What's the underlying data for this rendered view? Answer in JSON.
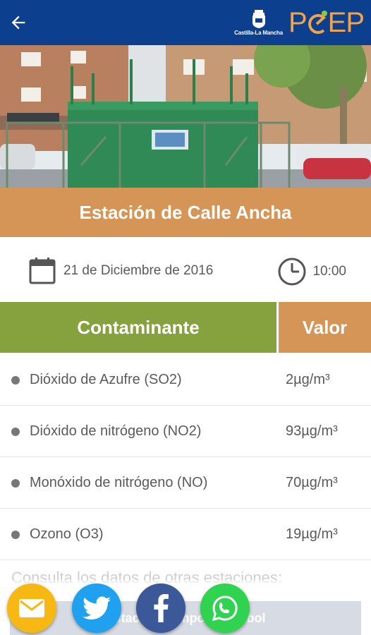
{
  "header": {
    "back_icon": "arrow-left-icon",
    "brand_region": "Castilla-La Mancha",
    "brand_logo": "PEEP",
    "colors": {
      "bar": "#0c3f8d",
      "logo": "#f0a24c",
      "logo_dot": "#8dc63f"
    }
  },
  "station": {
    "title": "Estación de Calle Ancha",
    "photo": "monitoring-station-photo"
  },
  "meta": {
    "date": "21 de Diciembre de 2016",
    "time": "10:00",
    "date_icon": "calendar-icon",
    "time_icon": "clock-icon"
  },
  "table": {
    "headers": {
      "pollutant": "Contaminante",
      "value": "Valor"
    },
    "colors": {
      "pollutant_header": "#85a23e",
      "value_header": "#d49556"
    },
    "rows": [
      {
        "name": "Dióxido de Azufre (SO2)",
        "value": "2µg/m³"
      },
      {
        "name": "Dióxido de nitrógeno (NO2)",
        "value": "93µg/m³"
      },
      {
        "name": "Monóxido de nitrógeno (NO)",
        "value": "70µg/m³"
      },
      {
        "name": "Ozono (O3)",
        "value": "19µg/m³"
      }
    ]
  },
  "footer": {
    "more_stations": "Consulta los datos de otras estaciones:",
    "bottom_button": "Estación Campo de Fútbol"
  },
  "share": [
    {
      "icon": "mail-icon",
      "color": "#f7b813"
    },
    {
      "icon": "twitter-icon",
      "color": "#1fa1f0"
    },
    {
      "icon": "facebook-icon",
      "color": "#3b5998"
    },
    {
      "icon": "whatsapp-icon",
      "color": "#2fd34f"
    }
  ]
}
